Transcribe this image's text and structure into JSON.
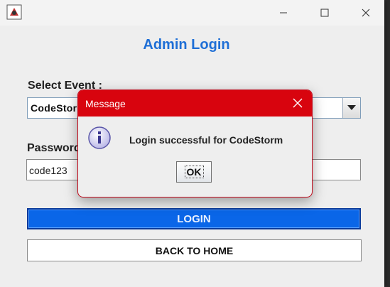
{
  "window": {
    "title_controls": [
      "minimize",
      "maximize",
      "close"
    ]
  },
  "form": {
    "heading": "Admin Login",
    "event_label": "Select Event :",
    "event_value": "CodeStorm",
    "password_label": "Password :",
    "password_value": "code123",
    "login_button": "LOGIN",
    "home_button": "BACK TO HOME"
  },
  "dialog": {
    "title": "Message",
    "message": "Login successful for CodeStorm",
    "ok_label": "OK",
    "icon": "info-icon"
  },
  "colors": {
    "accent": "#1f6fd6",
    "login_button": "#0a66e8",
    "dialog_titlebar": "#d8040e"
  }
}
